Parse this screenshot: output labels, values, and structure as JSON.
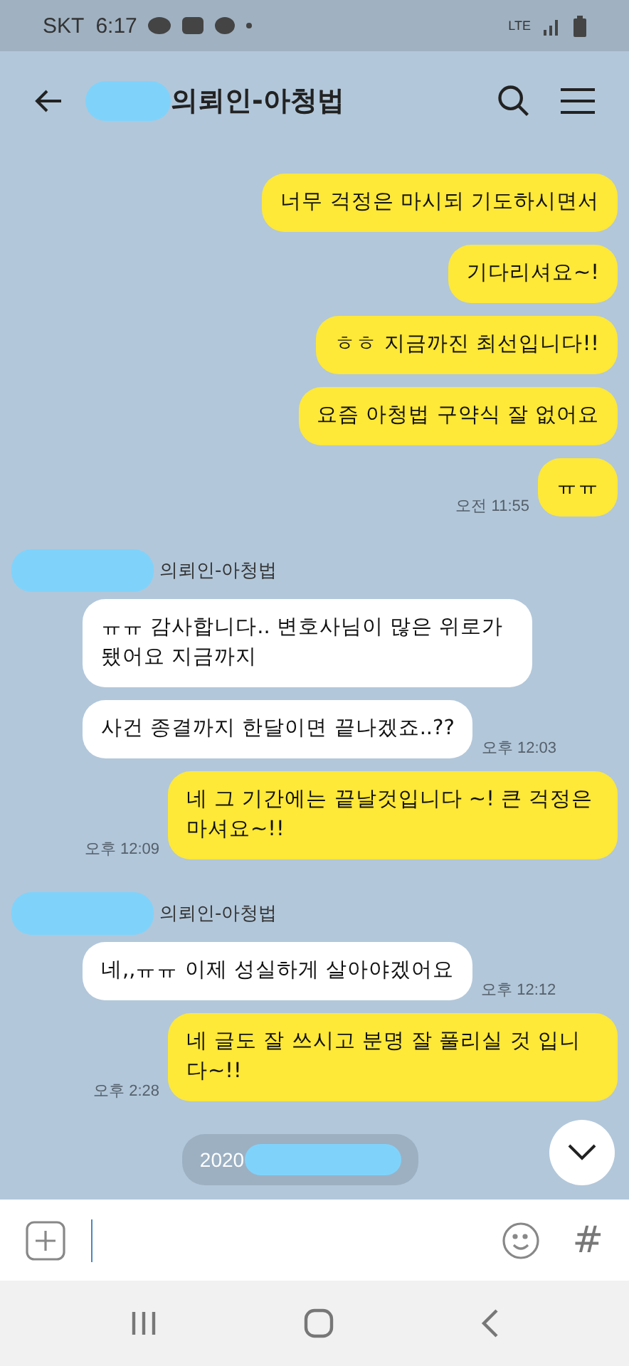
{
  "status_bar": {
    "carrier": "SKT",
    "time": "6:17",
    "network": "LTE"
  },
  "header": {
    "title": "의뢰인-아청법"
  },
  "input_bar": {
    "hashtag": "#"
  },
  "messages": [
    {
      "kind": "me",
      "text": "너무 걱정은 마시되 기도하시면서"
    },
    {
      "kind": "me",
      "text": "기다리셔요~!"
    },
    {
      "kind": "me",
      "text": "ㅎㅎ 지금까진 최선입니다!!"
    },
    {
      "kind": "me",
      "text": "요즘 아청법 구약식 잘 없어요"
    },
    {
      "kind": "me",
      "text": "ㅠㅠ",
      "time": "오전 11:55"
    },
    {
      "kind": "them",
      "sender": "의뢰인-아청법",
      "text": "ㅠㅠ 감사합니다.. 변호사님이 많은 위로가 됐어요 지금까지"
    },
    {
      "kind": "them",
      "text": "사건 종결까지 한달이면 끝나겠죠..??",
      "time": "오후 12:03"
    },
    {
      "kind": "me",
      "text": "네 그 기간에는 끝날것입니다 ~! 큰 걱정은 마셔요~!!",
      "time": "오후 12:09"
    },
    {
      "kind": "them",
      "sender": "의뢰인-아청법",
      "text": "네,,ㅠㅠ 이제 성실하게 살아야겠어요",
      "time": "오후 12:12"
    },
    {
      "kind": "me",
      "text": "네 글도 잘 쓰시고 분명 잘 풀리실 것 입니다~!!",
      "time": "오후 2:28"
    },
    {
      "kind": "date",
      "text": "2020"
    }
  ]
}
